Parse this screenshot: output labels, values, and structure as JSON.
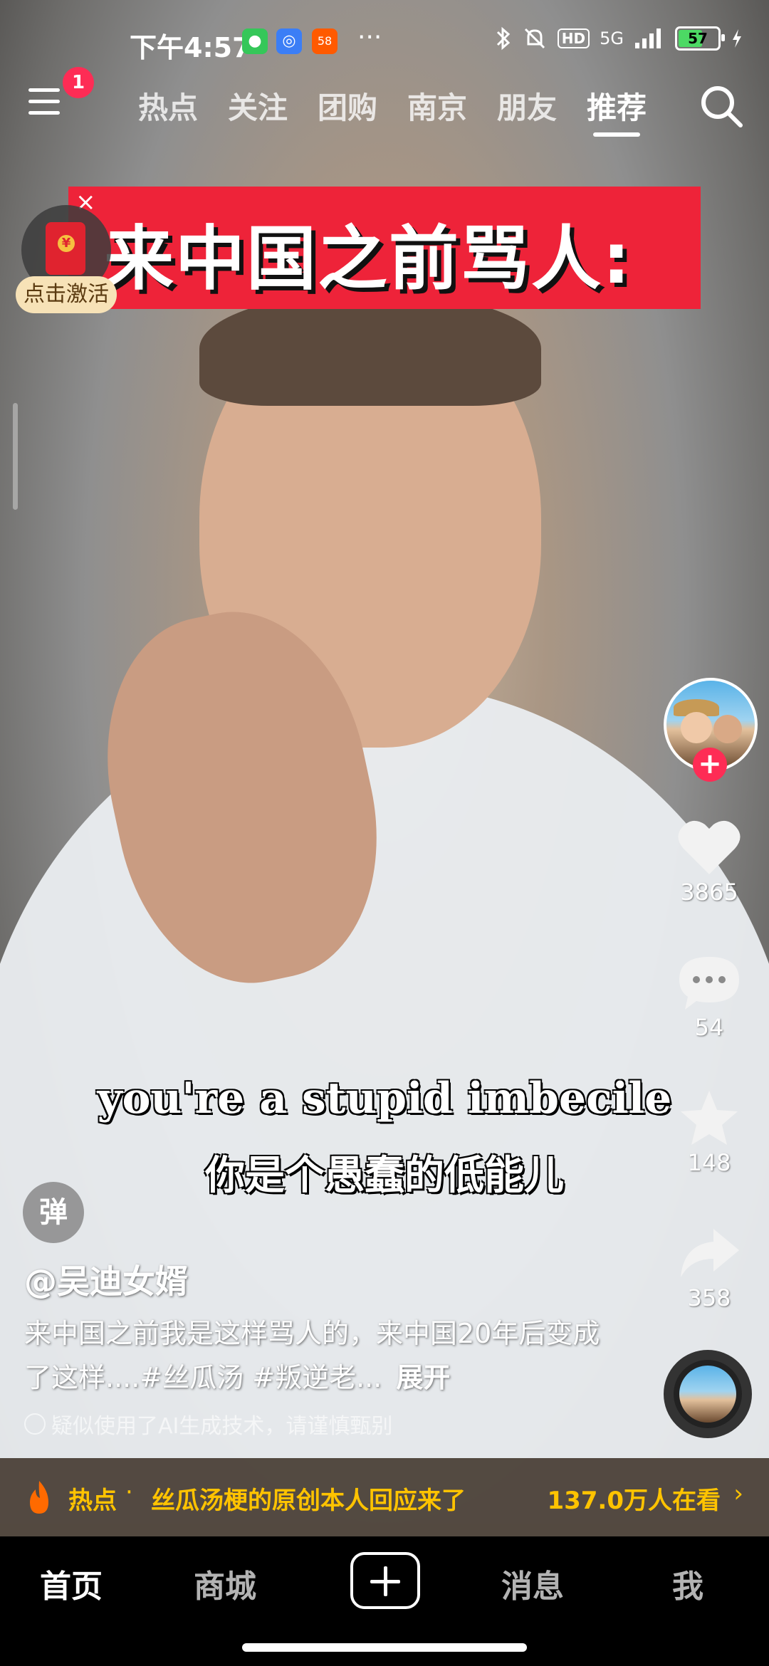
{
  "status_bar": {
    "time": "下午4:57",
    "app_icons": [
      "wechat-icon",
      "baidu-netdisk-icon",
      "58-app-icon"
    ],
    "app_58_label": "58",
    "more": "···",
    "network": "5G",
    "hd": "HD",
    "battery": "57",
    "battery_level_percent": 57
  },
  "top_nav": {
    "badge": "1",
    "tabs": [
      "热点",
      "关注",
      "团购",
      "南京",
      "朋友",
      "推荐"
    ],
    "active_tab": "推荐"
  },
  "video": {
    "banner_text": "来中国之前骂人:",
    "banner_close": "×",
    "activation_label": "点击激活",
    "subtitle_en": "you're a stupid imbecile",
    "subtitle_zh": "你是个愚蠢的低能儿",
    "danmu_button": "弹"
  },
  "right_rail": {
    "follow": "+",
    "likes": "3865",
    "comments": "54",
    "favorites": "148",
    "shares": "358"
  },
  "post": {
    "author": "@吴迪女婿",
    "caption": "来中国之前我是这样骂人的，来中国20年后变成了这样....#丝瓜汤 #叛逆老...",
    "expand": "展开",
    "ai_note": "疑似使用了AI生成技术，请谨慎甄别"
  },
  "hot_bar": {
    "label": "热点",
    "separator": "·",
    "text": "丝瓜汤梗的原创本人回应来了",
    "viewers": "137.0万人在看",
    "chevron": "›"
  },
  "bottom_nav": {
    "items": [
      "首页",
      "商城",
      "消息",
      "我"
    ],
    "active": "首页"
  },
  "colors": {
    "accent_red": "#fe2c55",
    "banner_red": "#ee2339",
    "hot_yellow": "#ffc300"
  }
}
